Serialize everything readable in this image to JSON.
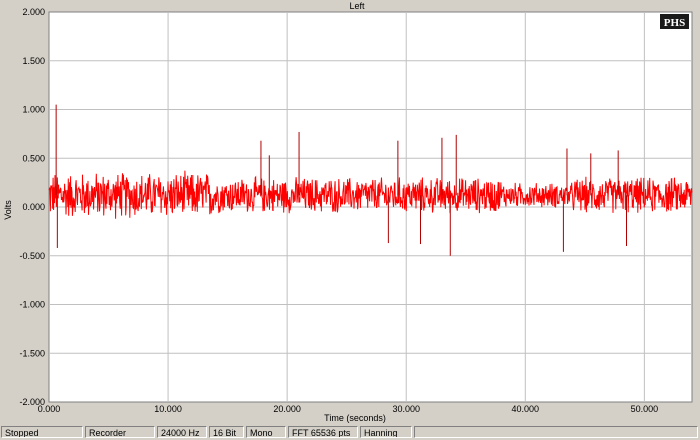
{
  "chart_data": {
    "type": "line",
    "title": "Left",
    "xlabel": "Time (seconds)",
    "ylabel": "Volts",
    "xlim": [
      0,
      54
    ],
    "ylim": [
      -2,
      2
    ],
    "x_ticks": [
      "0.000",
      "10.000",
      "20.000",
      "30.000",
      "40.000",
      "50.000"
    ],
    "y_ticks": [
      "2.000",
      "1.500",
      "1.000",
      "0.500",
      "0.000",
      "-0.500",
      "-1.000",
      "-1.500",
      "-2.000"
    ],
    "grid": true,
    "series": [
      {
        "color": "#ff0000",
        "baseline": 0.12,
        "spikes": [
          {
            "x": 0.6,
            "y": 1.05
          },
          {
            "x": 0.7,
            "y": -0.42
          },
          {
            "x": 17.8,
            "y": 0.68
          },
          {
            "x": 18.5,
            "y": 0.53
          },
          {
            "x": 21.0,
            "y": 0.77
          },
          {
            "x": 28.5,
            "y": -0.37
          },
          {
            "x": 29.3,
            "y": 0.68
          },
          {
            "x": 31.2,
            "y": -0.38
          },
          {
            "x": 33.0,
            "y": 0.71
          },
          {
            "x": 33.7,
            "y": -0.5
          },
          {
            "x": 34.2,
            "y": 0.74
          },
          {
            "x": 43.2,
            "y": -0.46
          },
          {
            "x": 43.5,
            "y": 0.6
          },
          {
            "x": 45.5,
            "y": 0.55
          },
          {
            "x": 47.8,
            "y": 0.58
          },
          {
            "x": 48.5,
            "y": -0.4
          }
        ]
      }
    ]
  },
  "watermark": "PHS",
  "statusbar": {
    "cells": [
      "Stopped",
      "Recorder",
      "24000 Hz",
      "16 Bit",
      "Mono",
      "FFT 65536 pts",
      "Hanning",
      ""
    ]
  }
}
